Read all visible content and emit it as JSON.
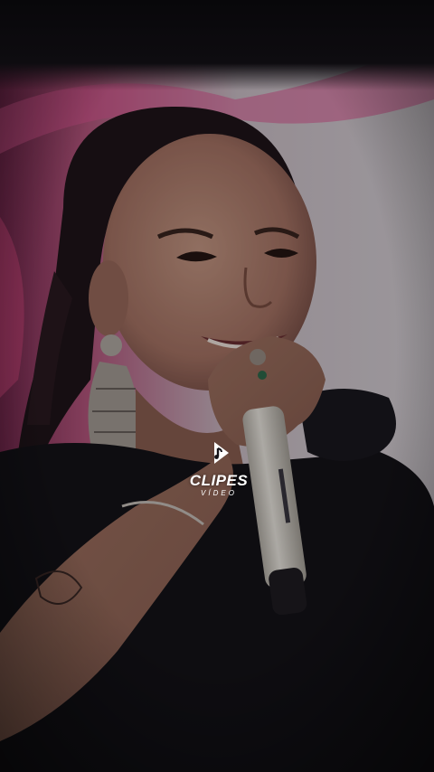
{
  "scene": {
    "subject": "singer-with-microphone",
    "colors": {
      "background_dark": "#0b0a0d",
      "backdrop_pink": "#c9407f",
      "backdrop_light": "#d7cfd6",
      "shirt": "#141218",
      "skin": "#b98674",
      "hair": "#1f1419",
      "mic_body": "#ddd8d0"
    }
  },
  "watermark": {
    "icon": "music-note-play-icon",
    "title": "CLIPES",
    "subtitle": "VÍDEO"
  }
}
